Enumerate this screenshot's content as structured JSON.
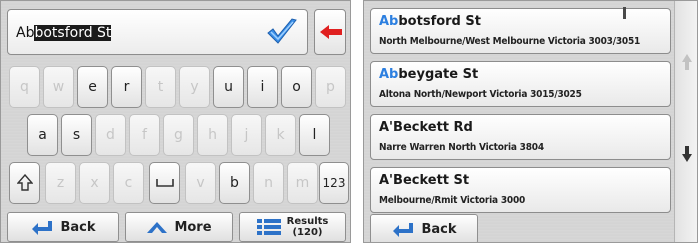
{
  "search": {
    "typed_prefix": "Ab",
    "autocomplete_suffix": "botsford St"
  },
  "keyboard": {
    "row1": [
      {
        "key": "q",
        "enabled": false
      },
      {
        "key": "w",
        "enabled": false
      },
      {
        "key": "e",
        "enabled": true
      },
      {
        "key": "r",
        "enabled": true
      },
      {
        "key": "t",
        "enabled": false
      },
      {
        "key": "y",
        "enabled": false
      },
      {
        "key": "u",
        "enabled": true
      },
      {
        "key": "i",
        "enabled": true
      },
      {
        "key": "o",
        "enabled": true
      },
      {
        "key": "p",
        "enabled": false
      }
    ],
    "row2": [
      {
        "key": "a",
        "enabled": true
      },
      {
        "key": "s",
        "enabled": true
      },
      {
        "key": "d",
        "enabled": false
      },
      {
        "key": "f",
        "enabled": false
      },
      {
        "key": "g",
        "enabled": false
      },
      {
        "key": "h",
        "enabled": false
      },
      {
        "key": "j",
        "enabled": false
      },
      {
        "key": "k",
        "enabled": false
      },
      {
        "key": "l",
        "enabled": true
      }
    ],
    "row3": [
      {
        "key": "z",
        "enabled": false
      },
      {
        "key": "x",
        "enabled": false
      },
      {
        "key": "c",
        "enabled": false
      },
      {
        "key": "v",
        "enabled": false
      },
      {
        "key": "b",
        "enabled": true
      },
      {
        "key": "n",
        "enabled": false
      },
      {
        "key": "m",
        "enabled": false
      }
    ],
    "numbers_key": "123"
  },
  "left_buttons": {
    "back": "Back",
    "more": "More",
    "results_line1": "Results",
    "results_line2": "(120)"
  },
  "results": [
    {
      "highlight": "Ab",
      "rest": "botsford St",
      "subtitle": "North Melbourne/West Melbourne Victoria 3003/3051"
    },
    {
      "highlight": "Ab",
      "rest": "beygate St",
      "subtitle": "Altona North/Newport Victoria 3015/3025"
    },
    {
      "highlight": "",
      "rest": "A'Beckett Rd",
      "subtitle": "Narre Warren North Victoria 3804"
    },
    {
      "highlight": "",
      "rest": "A'Beckett St",
      "subtitle": "Melbourne/Rmit Victoria 3000"
    }
  ],
  "right_buttons": {
    "back": "Back"
  },
  "colors": {
    "accent_blue": "#2c7fe0",
    "backspace_red": "#e02020",
    "check_blue": "#3a8fe8"
  }
}
